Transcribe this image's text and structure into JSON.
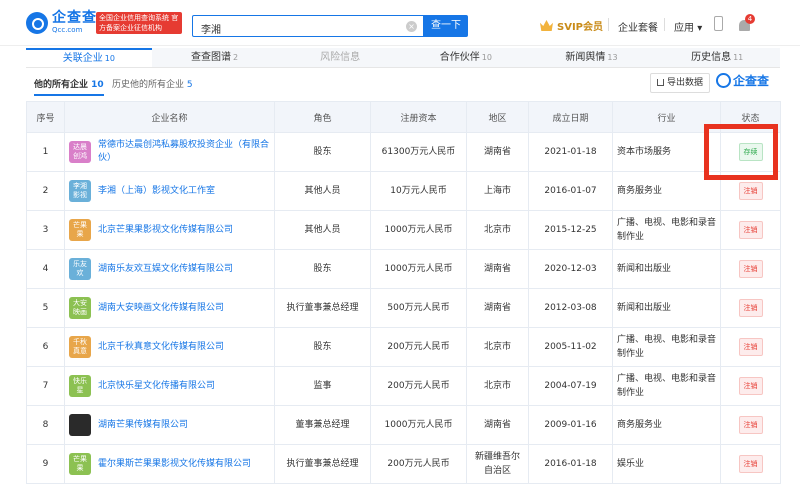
{
  "header": {
    "logo_cn": "企查查",
    "logo_en": "Qcc.com",
    "official_badge": "全国企业信用查询系统 官方备案企业征信机构",
    "search_value": "李湘",
    "search_button": "查一下",
    "svip": "SVIP会员",
    "links": [
      "企业套餐",
      "应用"
    ],
    "bell_count": "4",
    "colors": {
      "accent": "#1676e6",
      "danger": "#e63b32"
    }
  },
  "tabs": [
    {
      "label": "关联企业",
      "count": "10",
      "state": "active"
    },
    {
      "label": "查查图谱",
      "count": "2",
      "state": "normal"
    },
    {
      "label": "风险信息",
      "count": "",
      "state": "disabled"
    },
    {
      "label": "合作伙伴",
      "count": "10",
      "state": "normal"
    },
    {
      "label": "新闻舆情",
      "count": "13",
      "state": "normal"
    },
    {
      "label": "历史信息",
      "count": "11",
      "state": "normal"
    }
  ],
  "subtabs": {
    "current_label": "他的所有企业",
    "current_count": "10",
    "history_label": "历史他的所有企业",
    "history_count": "5"
  },
  "export_label": "导出数据",
  "watermark": "企查查",
  "table": {
    "headers": [
      "序号",
      "企业名称",
      "角色",
      "注册资本",
      "地区",
      "成立日期",
      "行业",
      "状态"
    ],
    "rows": [
      {
        "no": "1",
        "logo": "达晨 创鸿",
        "logo_color": "#d97fc9",
        "name": "常德市达晨创鸿私募股权投资企业（有限合伙）",
        "role": "股东",
        "capital": "61300万元人民币",
        "region": "湖南省",
        "date": "2021-01-18",
        "industry": "资本市场服务",
        "status": "存续",
        "status_type": "green"
      },
      {
        "no": "2",
        "logo": "李湘 影视",
        "logo_color": "#6ab0d9",
        "name": "李湘（上海）影视文化工作室",
        "role": "其他人员",
        "capital": "10万元人民币",
        "region": "上海市",
        "date": "2016-01-07",
        "industry": "商务服务业",
        "status": "注销",
        "status_type": "red"
      },
      {
        "no": "3",
        "logo": "芒果 果",
        "logo_color": "#e8a64a",
        "name": "北京芒果果影视文化传媒有限公司",
        "role": "其他人员",
        "capital": "1000万元人民币",
        "region": "北京市",
        "date": "2015-12-25",
        "industry": "广播、电视、电影和录音制作业",
        "status": "注销",
        "status_type": "red"
      },
      {
        "no": "4",
        "logo": "乐友 欢",
        "logo_color": "#6ab0d9",
        "name": "湖南乐友欢互娱文化传媒有限公司",
        "role": "股东",
        "capital": "1000万元人民币",
        "region": "湖南省",
        "date": "2020-12-03",
        "industry": "新闻和出版业",
        "status": "注销",
        "status_type": "red"
      },
      {
        "no": "5",
        "logo": "大安 映画",
        "logo_color": "#8cc152",
        "name": "湖南大安映画文化传媒有限公司",
        "role": "执行董事兼总经理",
        "capital": "500万元人民币",
        "region": "湖南省",
        "date": "2012-03-08",
        "industry": "新闻和出版业",
        "status": "注销",
        "status_type": "red"
      },
      {
        "no": "6",
        "logo": "千秋 真意",
        "logo_color": "#e8a64a",
        "name": "北京千秋真意文化传媒有限公司",
        "role": "股东",
        "capital": "200万元人民币",
        "region": "北京市",
        "date": "2005-11-02",
        "industry": "广播、电视、电影和录音制作业",
        "status": "注销",
        "status_type": "red"
      },
      {
        "no": "7",
        "logo": "快乐 星",
        "logo_color": "#8cc152",
        "name": "北京快乐星文化传播有限公司",
        "role": "监事",
        "capital": "200万元人民币",
        "region": "北京市",
        "date": "2004-07-19",
        "industry": "广播、电视、电影和录音制作业",
        "status": "注销",
        "status_type": "red"
      },
      {
        "no": "8",
        "logo": "",
        "logo_color": "#2a2a2a",
        "name": "湖南芒果传媒有限公司",
        "role": "董事兼总经理",
        "capital": "1000万元人民币",
        "region": "湖南省",
        "date": "2009-01-16",
        "industry": "商务服务业",
        "status": "注销",
        "status_type": "red"
      },
      {
        "no": "9",
        "logo": "芒果 果",
        "logo_color": "#8cc152",
        "name": "霍尔果斯芒果果影视文化传媒有限公司",
        "role": "执行董事兼总经理",
        "capital": "200万元人民币",
        "region": "新疆维吾尔自治区",
        "date": "2016-01-18",
        "industry": "娱乐业",
        "status": "注销",
        "status_type": "red"
      }
    ]
  }
}
